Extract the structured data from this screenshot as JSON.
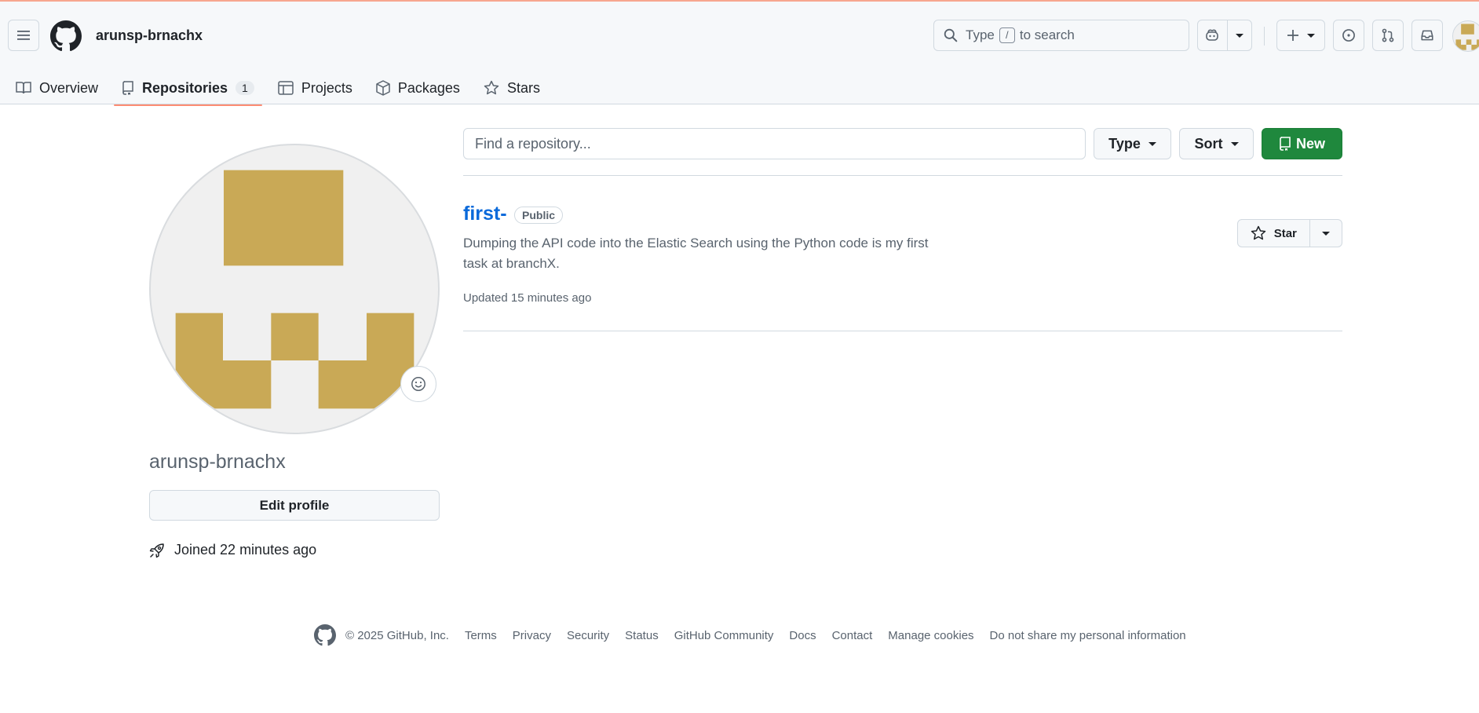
{
  "header": {
    "username": "arunsp-brnachx",
    "search": {
      "text_before": "Type",
      "key": "/",
      "text_after": "to search"
    }
  },
  "tabs": [
    {
      "label": "Overview",
      "icon": "book-icon"
    },
    {
      "label": "Repositories",
      "icon": "repo-icon",
      "count": "1",
      "active": true
    },
    {
      "label": "Projects",
      "icon": "table-icon"
    },
    {
      "label": "Packages",
      "icon": "package-icon"
    },
    {
      "label": "Stars",
      "icon": "star-icon"
    }
  ],
  "profile": {
    "name": "arunsp-brnachx",
    "edit_label": "Edit profile",
    "joined": "Joined 22 minutes ago",
    "avatar_color": "#c9a956"
  },
  "repo_toolbar": {
    "search_placeholder": "Find a repository...",
    "type_label": "Type",
    "sort_label": "Sort",
    "new_label": "New"
  },
  "repositories": [
    {
      "name": "first-",
      "visibility": "Public",
      "description": "Dumping the API code into the Elastic Search using the Python code is my first task at branchX.",
      "updated": "Updated 15 minutes ago",
      "star_label": "Star"
    }
  ],
  "footer": {
    "copyright": "© 2025 GitHub, Inc.",
    "links": [
      "Terms",
      "Privacy",
      "Security",
      "Status",
      "GitHub Community",
      "Docs",
      "Contact",
      "Manage cookies",
      "Do not share my personal information"
    ]
  },
  "colors": {
    "accent_green": "#1f883d",
    "link_blue": "#0969da",
    "tab_underline": "#fd8c73"
  }
}
